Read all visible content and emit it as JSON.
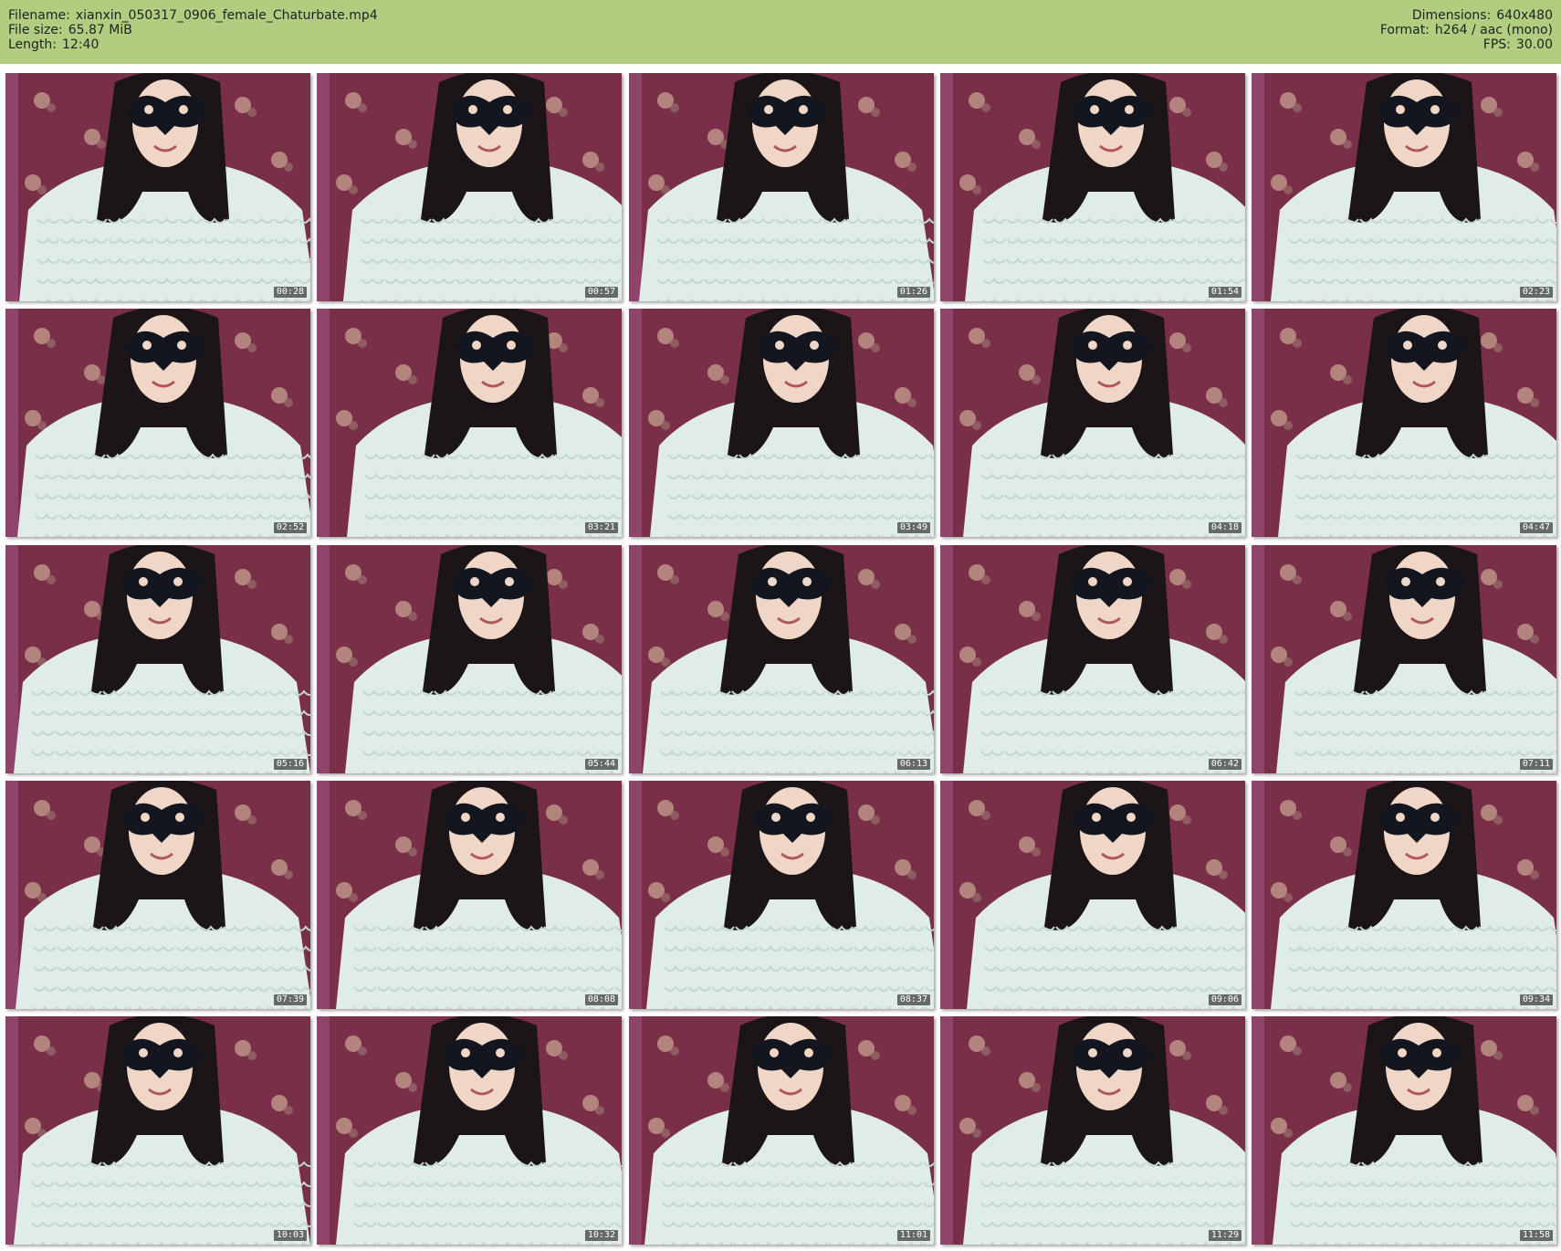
{
  "header": {
    "filename_label": "Filename:",
    "filename": "xianxin_050317_0906_female_Chaturbate.mp4",
    "filesize_label": "File size:",
    "filesize": "65.87 MiB",
    "length_label": "Length:",
    "length": "12:40",
    "dimensions_label": "Dimensions:",
    "dimensions": "640x480",
    "format_label": "Format:",
    "format": "h264 / aac (mono)",
    "fps_label": "FPS:",
    "fps": "30.00"
  },
  "colors": {
    "header_bg": "#b1cd80",
    "wallpaper": "#7a2f48",
    "sweater": "#dfece8",
    "hair": "#1b1517",
    "mask": "#14161f"
  },
  "thumbnails": [
    {
      "timestamp": "00:28"
    },
    {
      "timestamp": "00:57"
    },
    {
      "timestamp": "01:26"
    },
    {
      "timestamp": "01:54"
    },
    {
      "timestamp": "02:23"
    },
    {
      "timestamp": "02:52"
    },
    {
      "timestamp": "03:21"
    },
    {
      "timestamp": "03:49"
    },
    {
      "timestamp": "04:18"
    },
    {
      "timestamp": "04:47"
    },
    {
      "timestamp": "05:16"
    },
    {
      "timestamp": "05:44"
    },
    {
      "timestamp": "06:13"
    },
    {
      "timestamp": "06:42"
    },
    {
      "timestamp": "07:11"
    },
    {
      "timestamp": "07:39"
    },
    {
      "timestamp": "08:08"
    },
    {
      "timestamp": "08:37"
    },
    {
      "timestamp": "09:06"
    },
    {
      "timestamp": "09:34"
    },
    {
      "timestamp": "10:03"
    },
    {
      "timestamp": "10:32"
    },
    {
      "timestamp": "11:01"
    },
    {
      "timestamp": "11:29"
    },
    {
      "timestamp": "11:58"
    }
  ]
}
